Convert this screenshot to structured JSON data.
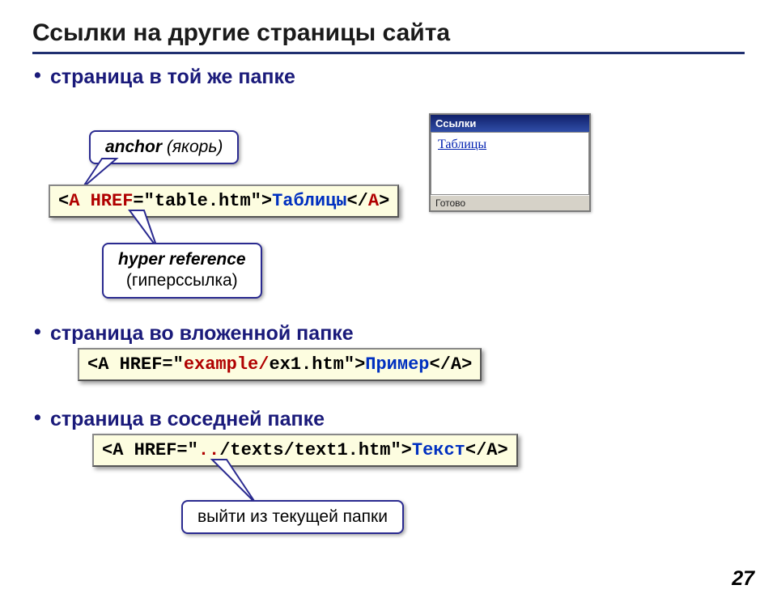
{
  "title": "Ссылки на другие страницы сайта",
  "bullets": {
    "b1": "страница в той же папке",
    "b2": "страница во вложенной папке",
    "b3": "страница в соседней папке"
  },
  "callouts": {
    "anchor_em": "anchor",
    "anchor_rest": " (якорь)",
    "href_em": "hyper reference",
    "href_rest": "(гиперссылка)",
    "updir": "выйти из текущей папки"
  },
  "code1": {
    "p1": "<",
    "a1": "A",
    "p2": " ",
    "href": "HREF",
    "p3": "=\"table.htm\">",
    "linktext": "Таблицы",
    "p4": "</",
    "a2": "A",
    "p5": ">"
  },
  "code2": {
    "p1": "<A HREF=\"",
    "dir": "example/",
    "p2": "ex1.htm\">",
    "linktext": "Пример",
    "p3": "</A>"
  },
  "code3": {
    "p1": "<A HREF=\"",
    "up": "..",
    "p2": "/texts/text1.htm\">",
    "linktext": "Текст",
    "p3": "</A>"
  },
  "browser": {
    "title": "Ссылки",
    "link": "Таблицы",
    "status": "Готово"
  },
  "pagenum": "27"
}
